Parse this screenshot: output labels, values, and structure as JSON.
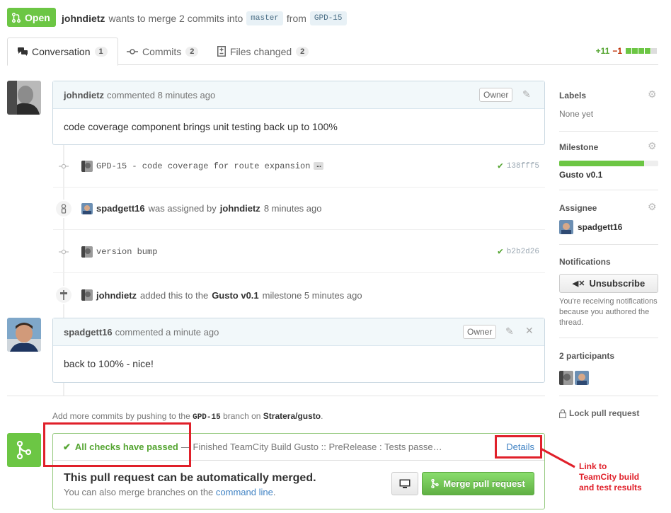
{
  "header": {
    "state": "Open",
    "author": "johndietz",
    "action_text": "wants to merge 2 commits into",
    "base_branch": "master",
    "from_text": "from",
    "head_branch": "GPD-15"
  },
  "tabs": [
    {
      "label": "Conversation",
      "count": "1",
      "icon": "comment-discussion-icon"
    },
    {
      "label": "Commits",
      "count": "2",
      "icon": "git-commit-icon"
    },
    {
      "label": "Files changed",
      "count": "2",
      "icon": "diff-icon"
    }
  ],
  "diffstat": {
    "additions": "+11",
    "deletions": "−1",
    "bar_green_squares": 4,
    "bar_total_squares": 5
  },
  "timeline": {
    "comment1": {
      "author": "johndietz",
      "meta": "commented 8 minutes ago",
      "role": "Owner",
      "body": "code coverage component brings unit testing back up to 100%"
    },
    "commit1": {
      "message": "GPD-15 - code coverage for route expansion",
      "ellipsis": "…",
      "sha": "138fff5"
    },
    "assign": {
      "user": "spadgett16",
      "text": "was assigned by",
      "by": "johndietz",
      "time": "8 minutes ago"
    },
    "commit2": {
      "message": "version bump",
      "sha": "b2b2d26"
    },
    "milestone": {
      "user": "johndietz",
      "text": "added this to the",
      "milestone": "Gusto v0.1",
      "suffix": "milestone 5 minutes ago"
    },
    "comment2": {
      "author": "spadgett16",
      "meta": "commented a minute ago",
      "role": "Owner",
      "body": "back to 100% - nice!"
    }
  },
  "hint": {
    "prefix": "Add more commits by pushing to the",
    "branch": "GPD-15",
    "middle": "branch on",
    "repo": "Stratera/gusto",
    "suffix": "."
  },
  "merge": {
    "checks_status": "All checks have passed",
    "checks_detail": "— Finished TeamCity Build Gusto :: PreRelease : Tests passe…",
    "details_link": "Details",
    "title": "This pull request can be automatically merged.",
    "sub_prefix": "You can also merge branches on the",
    "sub_link": "command line",
    "sub_suffix": ".",
    "merge_button": "Merge pull request"
  },
  "annotation": {
    "line1": "Link to",
    "line2": "TeamCity build",
    "line3": "and test results",
    "color": "#e0202a"
  },
  "sidebar": {
    "labels_title": "Labels",
    "labels_value": "None yet",
    "milestone_title": "Milestone",
    "milestone_value": "Gusto v0.1",
    "milestone_progress": 0.86,
    "assignee_title": "Assignee",
    "assignee_value": "spadgett16",
    "notifications_title": "Notifications",
    "unsubscribe_label": "Unsubscribe",
    "notifications_text": "You're receiving notifications because you authored the thread.",
    "participants_title": "2 participants",
    "lock_label": "Lock pull request"
  },
  "colors": {
    "open_green": "#6cc644",
    "link_blue": "#4183c4",
    "annotation_red": "#e0202a"
  }
}
